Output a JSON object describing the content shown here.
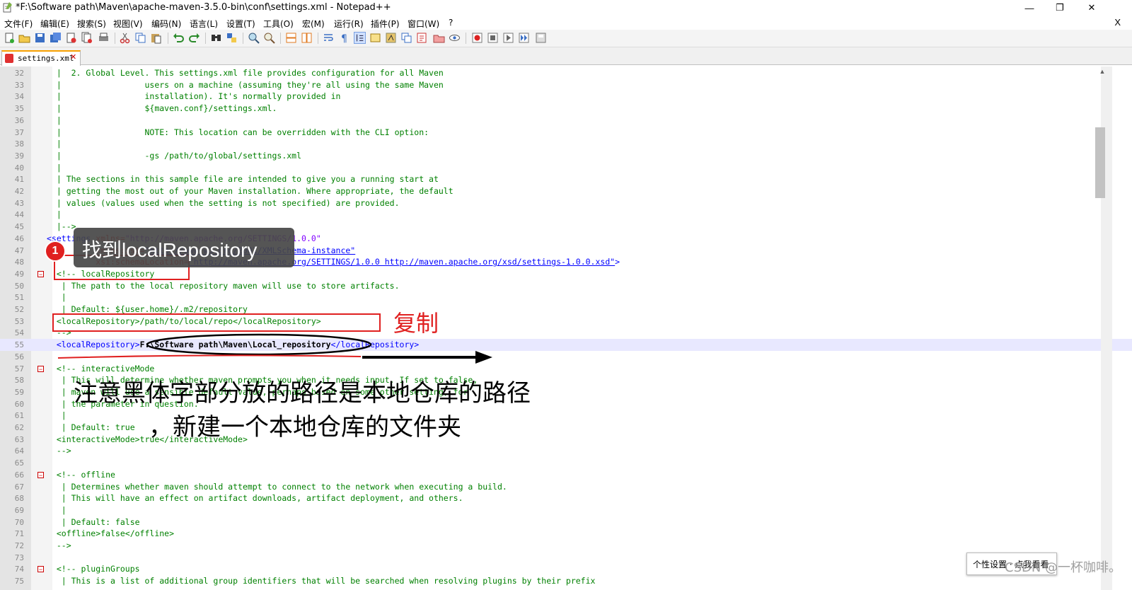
{
  "window": {
    "title": "*F:\\Software path\\Maven\\apache-maven-3.5.0-bin\\conf\\settings.xml - Notepad++",
    "minimize": "—",
    "maximize": "❐",
    "close": "✕"
  },
  "menu": {
    "items": [
      "文件(F)",
      "编辑(E)",
      "搜索(S)",
      "视图(V)",
      "编码(N)",
      "语言(L)",
      "设置(T)",
      "工具(O)",
      "宏(M)",
      "运行(R)",
      "插件(P)",
      "窗口(W)",
      "?"
    ],
    "close": "X"
  },
  "tab": {
    "label": "settings.xml",
    "close": "✕"
  },
  "editor": {
    "lines": [
      {
        "n": "32",
        "text": "  |  2. Global Level. This settings.xml file provides configuration for all Maven"
      },
      {
        "n": "33",
        "text": "  |                 users on a machine (assuming they're all using the same Maven"
      },
      {
        "n": "34",
        "text": "  |                 installation). It's normally provided in"
      },
      {
        "n": "35",
        "text": "  |                 ${maven.conf}/settings.xml."
      },
      {
        "n": "36",
        "text": "  |"
      },
      {
        "n": "37",
        "text": "  |                 NOTE: This location can be overridden with the CLI option:"
      },
      {
        "n": "38",
        "text": "  |"
      },
      {
        "n": "39",
        "text": "  |                 -gs /path/to/global/settings.xml"
      },
      {
        "n": "40",
        "text": "  |"
      },
      {
        "n": "41",
        "text": "  | The sections in this sample file are intended to give you a running start at"
      },
      {
        "n": "42",
        "text": "  | getting the most out of your Maven installation. Where appropriate, the default"
      },
      {
        "n": "43",
        "text": "  | values (values used when the setting is not specified) are provided."
      },
      {
        "n": "44",
        "text": "  |"
      },
      {
        "n": "45",
        "text": "  |-->"
      },
      {
        "n": "46",
        "tag": "<settings ",
        "attr": "xmlns=",
        "val": "\"http://maven.apache.org/SETTINGS/1.0.0\""
      },
      {
        "n": "47",
        "pad": "          ",
        "attr": "xmlns:xsi=",
        "val": "\"http://www.w3.org/2001/XMLSchema-instance\""
      },
      {
        "n": "48",
        "pad": "          ",
        "attr": "xsi:schemaLocation=",
        "val": "\"http://maven.apache.org/SETTINGS/1.0.0 http://maven.apache.org/xsd/settings-1.0.0.xsd\"",
        "end": ">"
      },
      {
        "n": "49",
        "text": "  <!-- localRepository"
      },
      {
        "n": "50",
        "text": "   | The path to the local repository maven will use to store artifacts."
      },
      {
        "n": "51",
        "text": "   |"
      },
      {
        "n": "52",
        "text": "   | Default: ${user.home}/.m2/repository"
      },
      {
        "n": "53",
        "text": "  <localRepository>/path/to/local/repo</localRepository>"
      },
      {
        "n": "54",
        "text": "  -->"
      },
      {
        "n": "55",
        "open": "  <localRepository>",
        "value": "F:\\Software path\\Maven\\Local_repository",
        "close": "</localRepository>"
      },
      {
        "n": "56",
        "text": ""
      },
      {
        "n": "57",
        "text": "  <!-- interactiveMode"
      },
      {
        "n": "58",
        "text": "   | This will determine whether maven prompts you when it needs input. If set to false,"
      },
      {
        "n": "59",
        "text": "   | maven will use a sensible default value, perhaps based on some other setting, for"
      },
      {
        "n": "60",
        "text": "   | the parameter in question."
      },
      {
        "n": "61",
        "text": "   |"
      },
      {
        "n": "62",
        "text": "   | Default: true"
      },
      {
        "n": "63",
        "text": "  <interactiveMode>true</interactiveMode>"
      },
      {
        "n": "64",
        "text": "  -->"
      },
      {
        "n": "65",
        "text": ""
      },
      {
        "n": "66",
        "text": "  <!-- offline"
      },
      {
        "n": "67",
        "text": "   | Determines whether maven should attempt to connect to the network when executing a build."
      },
      {
        "n": "68",
        "text": "   | This will have an effect on artifact downloads, artifact deployment, and others."
      },
      {
        "n": "69",
        "text": "   |"
      },
      {
        "n": "70",
        "text": "   | Default: false"
      },
      {
        "n": "71",
        "text": "  <offline>false</offline>"
      },
      {
        "n": "72",
        "text": "  -->"
      },
      {
        "n": "73",
        "text": ""
      },
      {
        "n": "74",
        "text": "  <!-- pluginGroups"
      },
      {
        "n": "75",
        "text": "   | This is a list of additional group identifiers that will be searched when resolving plugins by their prefix"
      }
    ]
  },
  "annotations": {
    "step_number": "1",
    "find_label": "找到localRepository",
    "copy_label": "复制",
    "note_line1": "注意黑体字部分放的路径是本地仓库的路径",
    "note_line2": "，新建一个本地仓库的文件夹"
  },
  "popup": {
    "text": "个性设置  · 点我看看"
  },
  "watermark": "CSDN @一杯咖啡。",
  "icons": [
    "new-file-icon",
    "open-icon",
    "save-icon",
    "save-all-icon",
    "close-icon",
    "close-all-icon",
    "print-icon",
    "cut-icon",
    "copy-icon",
    "paste-icon",
    "undo-icon",
    "redo-icon",
    "find-icon",
    "replace-icon",
    "zoom-in-icon",
    "zoom-out-icon",
    "sync-v-icon",
    "sync-h-icon",
    "wrap-icon",
    "all-chars-icon",
    "indent-guide-icon",
    "doc-map-icon",
    "function-list-icon",
    "folder-workspace-icon",
    "monitor-icon",
    "record-icon",
    "stop-icon",
    "play-icon",
    "play-multi-icon",
    "save-macro-icon"
  ]
}
